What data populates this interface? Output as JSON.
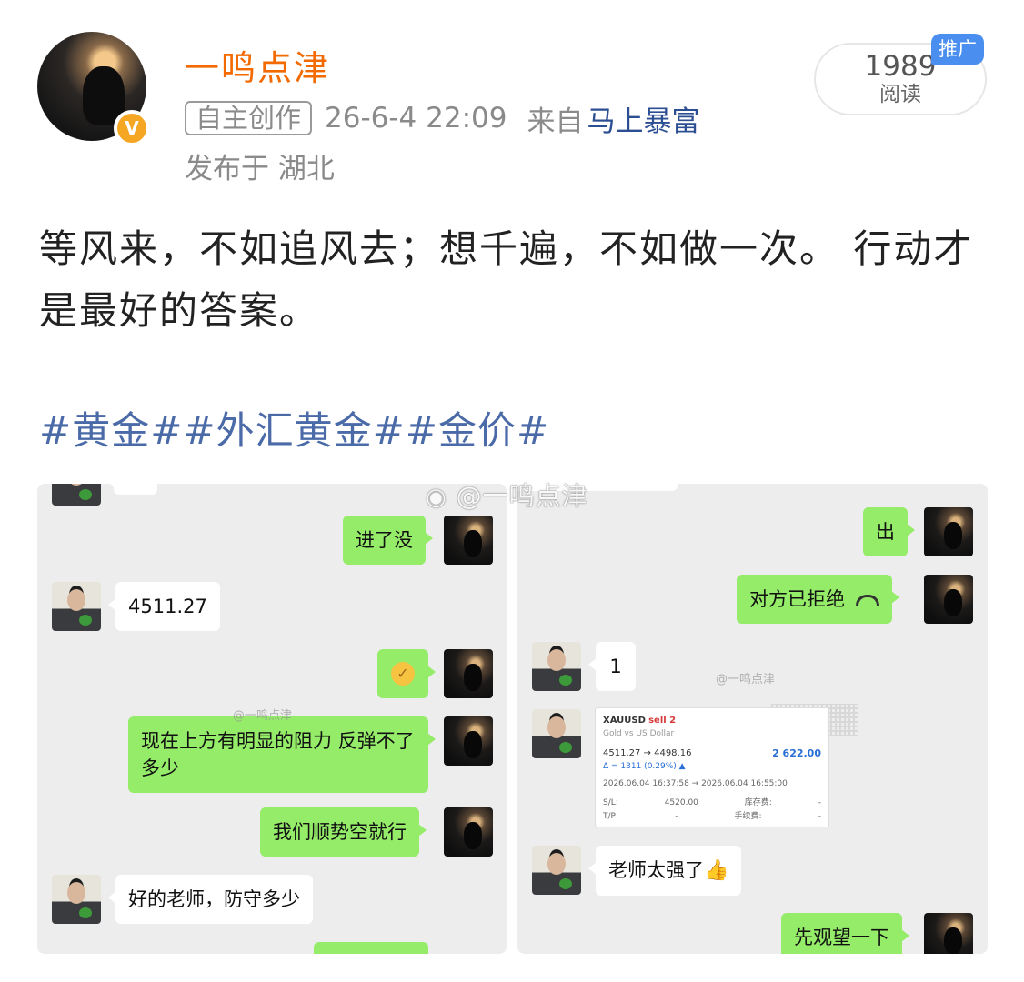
{
  "post": {
    "username": "一鸣点津",
    "tag": "自主创作",
    "datetime": "26-6-4 22:09",
    "source_prefix": "来自",
    "source": "马上暴富",
    "location": "发布于 湖北",
    "read_count": "1989",
    "read_label": "阅读",
    "promo": "推广",
    "content": "等风来，不如追风去；想千遍，不如做一次。 行动才是最好的答案。",
    "topics": "#黄金##外汇黄金##金价#"
  },
  "watermark": "@一鸣点津",
  "watermark_small": "@一鸣点津",
  "chat_left": {
    "msg1": "进了没",
    "msg2": "4511.27",
    "msg4": "现在上方有明显的阻力 反弹不了多少",
    "msg5": "我们顺势空就行",
    "msg6": "好的老师，防守多少"
  },
  "chat_right": {
    "msg1": "出",
    "msg2": "对方已拒绝",
    "msg3": "1",
    "msg5": "老师太强了",
    "msg6": "先观望一下"
  },
  "trade": {
    "symbol": "XAUUSD",
    "side": "sell 2",
    "desc": "Gold vs US Dollar",
    "prices": "4511.27 → 4498.16",
    "profit": "2 622.00",
    "delta": "Δ = 1311 (0.29%) ▲",
    "dates": "2026.06.04 16:37:58 → 2026.06.04 16:55:00",
    "sl_label": "S/L:",
    "sl_value": "4520.00",
    "fee_label": "库存费:",
    "fee_value": "-",
    "tp_label": "T/P:",
    "tp_value": "-",
    "commission_label": "手续费:",
    "commission_value": "-"
  }
}
